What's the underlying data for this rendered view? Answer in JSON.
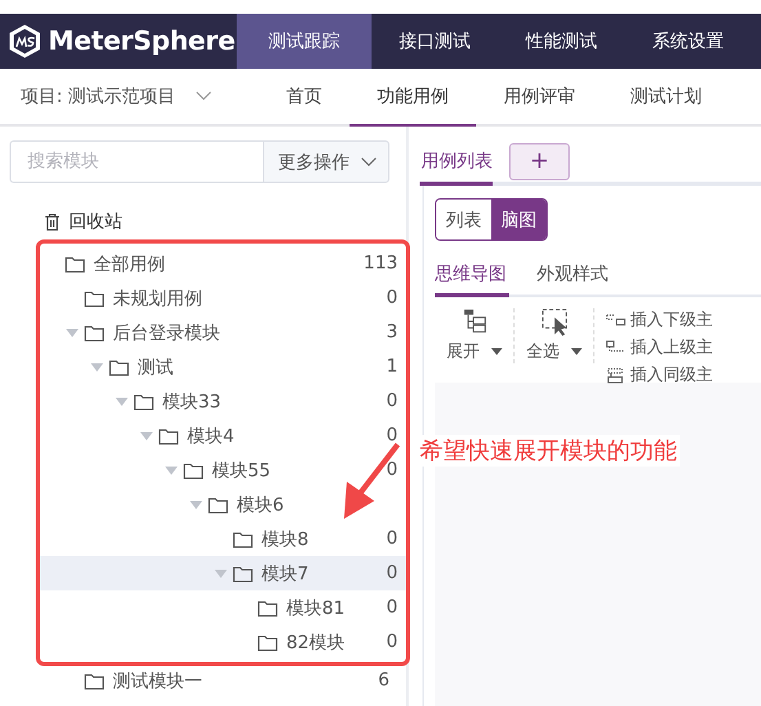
{
  "header": {
    "logo": "MeterSphere",
    "tabs": [
      {
        "label": "测试跟踪",
        "selected": true
      },
      {
        "label": "接口测试",
        "selected": false
      },
      {
        "label": "性能测试",
        "selected": false
      },
      {
        "label": "系统设置",
        "selected": false
      }
    ]
  },
  "subnav": {
    "project": "项目: 测试示范项目",
    "tabs": [
      {
        "label": "首页",
        "selected": false
      },
      {
        "label": "功能用例",
        "selected": true
      },
      {
        "label": "用例评审",
        "selected": false
      },
      {
        "label": "测试计划",
        "selected": false
      }
    ]
  },
  "sidebar": {
    "search": {
      "placeholder": "搜索模块"
    },
    "more_button": "更多操作",
    "recycle": "回收站",
    "tree": [
      {
        "label": "全部用例",
        "count": "113",
        "selected": false,
        "children": [
          {
            "label": "未规划用例",
            "count": "0",
            "selected": false
          },
          {
            "label": "后台登录模块",
            "count": "3",
            "selected": false,
            "expanded": true,
            "children": [
              {
                "label": "测试",
                "count": "1",
                "selected": false,
                "expanded": true,
                "children": [
                  {
                    "label": "模块33",
                    "count": "0",
                    "selected": false,
                    "expanded": true,
                    "children": [
                      {
                        "label": "模块4",
                        "count": "0",
                        "selected": false,
                        "expanded": true,
                        "children": [
                          {
                            "label": "模块55",
                            "count": "0",
                            "selected": false,
                            "expanded": true,
                            "children": [
                              {
                                "label": "模块6",
                                "selected": false,
                                "expanded": true,
                                "children": [
                                  {
                                    "label": "模块8",
                                    "count": "0",
                                    "selected": false
                                  },
                                  {
                                    "label": "模块7",
                                    "count": "0",
                                    "selected": true,
                                    "expanded": true,
                                    "children": [
                                      {
                                        "label": "模块81",
                                        "count": "0",
                                        "selected": false
                                      },
                                      {
                                        "label": "82模块",
                                        "count": "0",
                                        "selected": false
                                      }
                                    ]
                                  }
                                ]
                              }
                            ]
                          }
                        ]
                      }
                    ]
                  }
                ]
              }
            ]
          },
          {
            "label": "测试模块一",
            "count": "6",
            "selected": false
          }
        ]
      }
    ]
  },
  "editor": {
    "tabs": [
      {
        "label": "用例列表",
        "selected": true
      }
    ],
    "add_button": "+",
    "view_toggle": [
      {
        "label": "列表",
        "selected": false
      },
      {
        "label": "脑图",
        "selected": true
      }
    ],
    "mind_tabs": [
      {
        "label": "思维导图",
        "selected": true
      },
      {
        "label": "外观样式",
        "selected": false
      }
    ],
    "tools": [
      {
        "kind": "expand",
        "label": "展开"
      },
      {
        "kind": "select",
        "label": "全选"
      }
    ],
    "insert_tools": [
      {
        "kind": "child",
        "label": "插入下级主"
      },
      {
        "kind": "parent",
        "label": "插入上级主"
      },
      {
        "kind": "sibling",
        "label": "插入同级主"
      }
    ]
  },
  "annotation": {
    "text": "希望快速展开模块的功能"
  }
}
